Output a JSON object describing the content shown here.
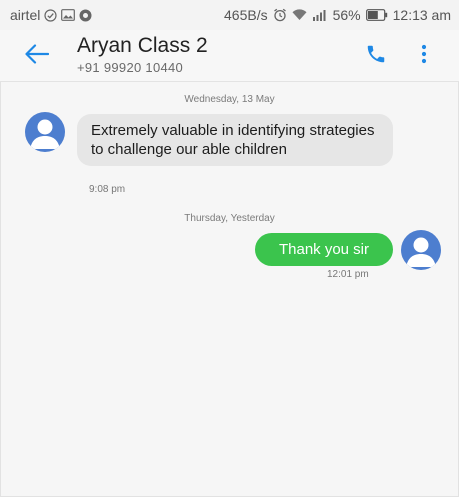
{
  "status_bar": {
    "carrier": "airtel",
    "speed": "465B/s",
    "battery": "56%",
    "time": "12:13 am",
    "icons": [
      "check-circle-icon",
      "image-icon",
      "app-icon",
      "alarm-icon",
      "wifi-icon",
      "signal-icon",
      "battery-icon"
    ]
  },
  "header": {
    "contact_name": "Aryan Class 2",
    "contact_number": "+91 99920 10440",
    "back_icon": "back-arrow-icon",
    "call_icon": "phone-icon",
    "menu_icon": "more-vert-icon"
  },
  "conversation": {
    "date_1": "Wednesday, 13 May",
    "message_in": {
      "text": "Extremely valuable in identifying strategies to challenge our able children",
      "time": "9:08 pm"
    },
    "date_2": "Thursday, Yesterday",
    "message_out": {
      "text": "Thank you sir",
      "time": "12:01 pm"
    }
  },
  "colors": {
    "accent": "#1e88e5",
    "outgoing_bubble": "#3bc44d",
    "incoming_bubble": "#e6e6e6",
    "avatar": "#4d7ecf"
  }
}
